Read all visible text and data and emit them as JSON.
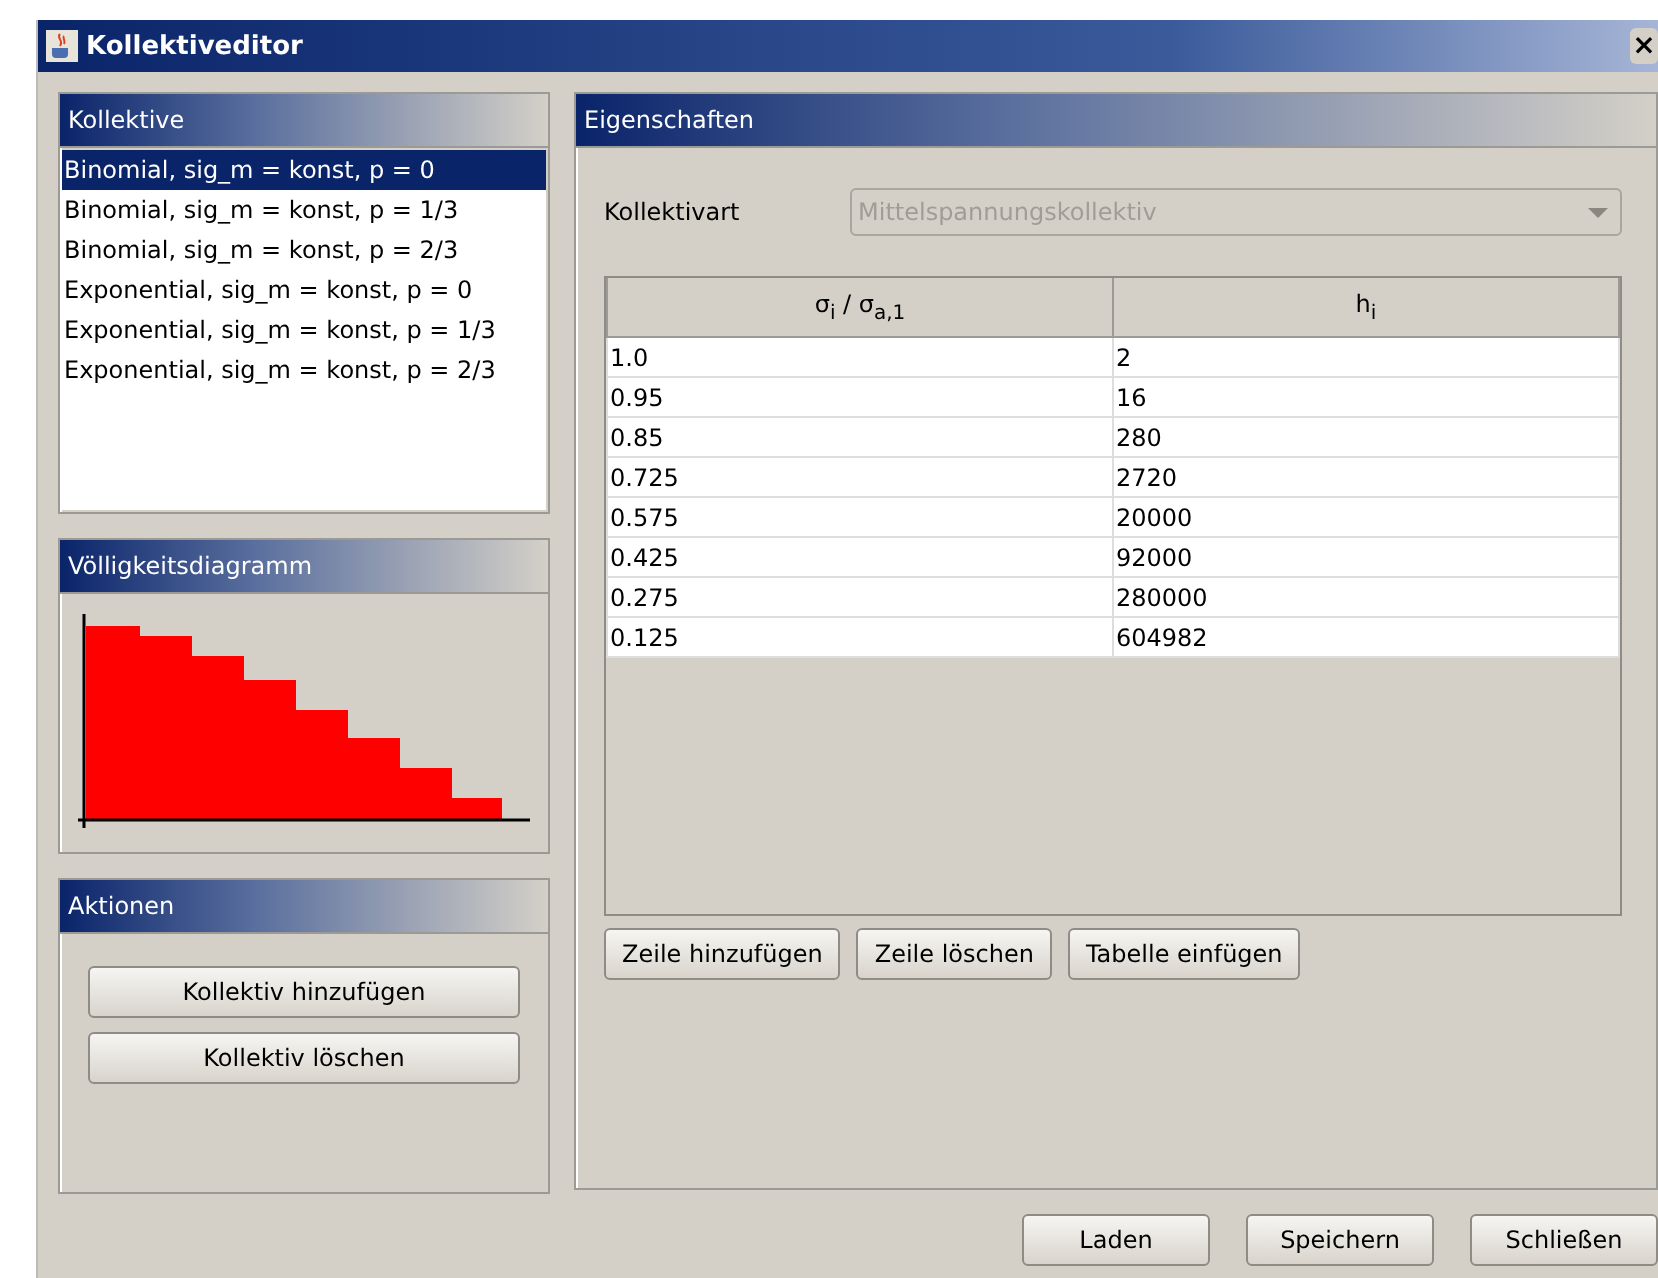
{
  "window": {
    "title": "Kollektiveditor",
    "close": "×"
  },
  "kollektive": {
    "title": "Kollektive",
    "items": [
      {
        "label": "Binomial, sig_m = konst, p = 0",
        "selected": true
      },
      {
        "label": "Binomial, sig_m = konst, p = 1/3",
        "selected": false
      },
      {
        "label": "Binomial, sig_m = konst, p = 2/3",
        "selected": false
      },
      {
        "label": "Exponential, sig_m = konst, p = 0",
        "selected": false
      },
      {
        "label": "Exponential, sig_m = konst, p = 1/3",
        "selected": false
      },
      {
        "label": "Exponential, sig_m = konst, p = 2/3",
        "selected": false
      }
    ]
  },
  "diagramm": {
    "title": "Völligkeitsdiagramm",
    "kind": "picture"
  },
  "aktionen": {
    "title": "Aktionen",
    "buttons": [
      "Kollektiv hinzufügen",
      "Kollektiv löschen"
    ]
  },
  "eigenschaften": {
    "title": "Eigenschaften",
    "kollektivart": {
      "label": "Kollektivart",
      "value": "Mittelspannungskollektiv",
      "disabled": true
    },
    "table": {
      "columns": [
        "σ$_{i}$ / σ$_{a,1}$",
        "h$_{i}$"
      ],
      "rows": [
        [
          "1.0",
          "2"
        ],
        [
          "0.95",
          "16"
        ],
        [
          "0.85",
          "280"
        ],
        [
          "0.725",
          "2720"
        ],
        [
          "0.575",
          "20000"
        ],
        [
          "0.425",
          "92000"
        ],
        [
          "0.275",
          "280000"
        ],
        [
          "0.125",
          "604982"
        ]
      ]
    },
    "buttons": [
      "Zeile hinzufügen",
      "Zeile löschen",
      "Tabelle einfügen"
    ]
  },
  "footer_buttons": [
    "Laden",
    "Speichern",
    "Schließen"
  ]
}
